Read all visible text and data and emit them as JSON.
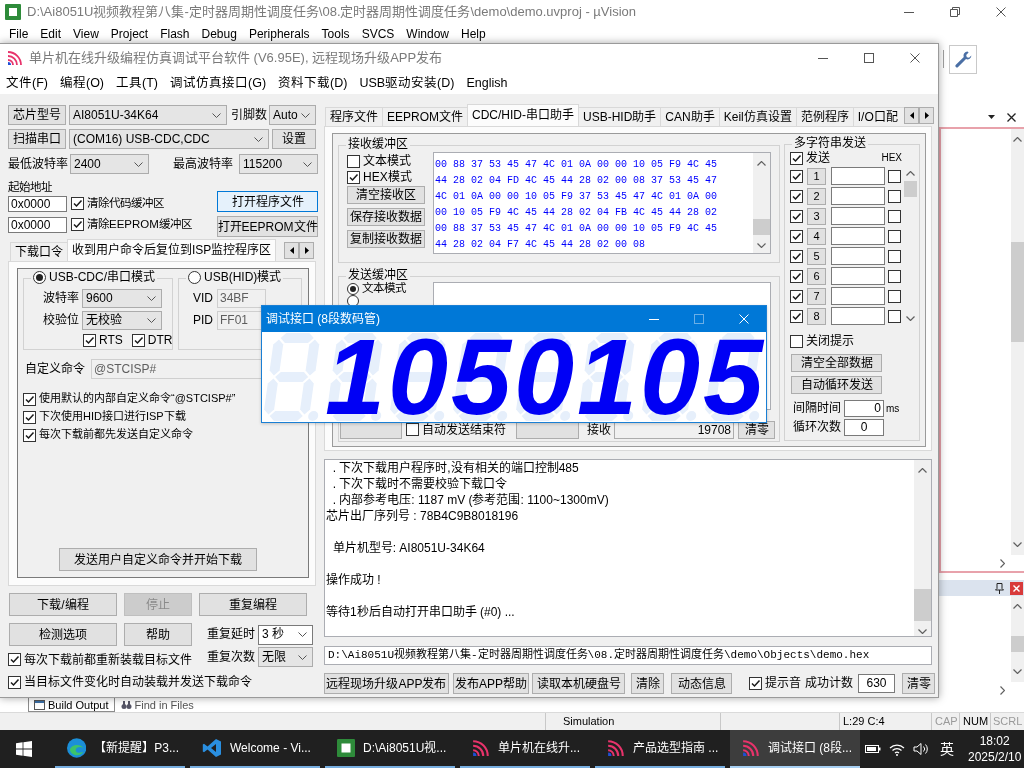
{
  "ide_window": {
    "title": "D:\\Ai8051U视频教程第八集-定时器周期性调度任务\\08.定时器周期性调度任务\\demo\\demo.uvproj - µVision",
    "menu": [
      "File",
      "Edit",
      "View",
      "Project",
      "Flash",
      "Debug",
      "Peripherals",
      "Tools",
      "SVCS",
      "Window",
      "Help"
    ],
    "output_tabs": [
      {
        "label": "Build Output",
        "selected": true
      },
      {
        "label": "Find in Files",
        "selected": false
      }
    ],
    "status_bar": {
      "mode": "Simulation",
      "position": "L:29 C:4",
      "indicators": [
        {
          "label": "CAP",
          "on": false
        },
        {
          "label": "NUM",
          "on": true
        },
        {
          "label": "SCRL",
          "on": false
        }
      ]
    }
  },
  "isp_window": {
    "title": "单片机在线升级编程仿真调试平台软件 (V6.95E), 远程现场升级APP发布",
    "menu": [
      "文件(F)",
      "编程(O)",
      "工具(T)",
      "调试仿真接口(G)",
      "资料下载(D)",
      "USB驱动安装(D)",
      "English"
    ],
    "chip_button": "芯片型号",
    "chip": "AI8051U-34K64",
    "pins_label": "引脚数",
    "pins": "Auto",
    "scan_button": "扫描串口",
    "port": "(COM16) USB-CDC,CDC",
    "settings_button": "设置",
    "min_baud_label": "最低波特率",
    "min_baud": "2400",
    "max_baud_label": "最高波特率",
    "max_baud": "115200",
    "start_address_label": "起始地址",
    "buffers": [
      {
        "address": "0x0000",
        "label": "清除代码缓冲区",
        "checked": true,
        "button": "打开程序文件",
        "focused": true
      },
      {
        "address": "0x0000",
        "label": "清除EEPROM缓冲区",
        "checked": true,
        "button": "打开EEPROM文件",
        "focused": false
      }
    ],
    "option_tabs": [
      {
        "label": "下载口令",
        "selected": false
      },
      {
        "label": "收到用户命令后复位到ISP监控程序区",
        "selected": true
      }
    ],
    "modes": [
      {
        "label": "USB-CDC/串口模式",
        "selected": true,
        "fields": [
          {
            "kind": "dropdown",
            "label": "波特率",
            "value": "9600"
          },
          {
            "kind": "dropdown",
            "label": "校验位",
            "value": "无校验"
          }
        ],
        "flags": [
          {
            "label": "RTS",
            "checked": true
          },
          {
            "label": "DTR",
            "checked": true
          }
        ]
      },
      {
        "label": "USB(HID)模式",
        "selected": false,
        "fields": [
          {
            "kind": "text",
            "label": "VID",
            "value": "34BF"
          },
          {
            "kind": "text",
            "label": "PID",
            "value": "FF01"
          }
        ]
      }
    ],
    "custom_command": {
      "label": "自定义命令",
      "value": "@STCISP#",
      "disabled": true
    },
    "command_options": [
      {
        "label": "使用默认的内部自定义命令“@STCISP#”",
        "checked": true
      },
      {
        "label": "下次使用HID接口进行ISP下载",
        "checked": true
      },
      {
        "label": "每次下载前都先发送自定义命令",
        "checked": true
      }
    ],
    "send_command_button": "发送用户自定义命令并开始下载",
    "actions": [
      {
        "label": "下载/编程",
        "disabled": false
      },
      {
        "label": "停止",
        "disabled": true
      },
      {
        "label": "重复编程",
        "disabled": false
      },
      {
        "label": "检测选项",
        "disabled": false
      },
      {
        "label": "帮助",
        "disabled": false
      }
    ],
    "repeat_delay_label": "重复延时",
    "repeat_delay": "3 秒",
    "repeat_count_label": "重复次数",
    "repeat_count": "无限",
    "reload_options": [
      {
        "label": "每次下载前都重新装载目标文件",
        "checked": true
      },
      {
        "label": "当目标文件变化时自动装载并发送下载命令",
        "checked": true
      }
    ],
    "tool_tabs": [
      {
        "label": "程序文件",
        "selected": false
      },
      {
        "label": "EEPROM文件",
        "selected": false
      },
      {
        "label": "CDC/HID-串口助手",
        "selected": true
      },
      {
        "label": "USB-HID助手",
        "selected": false
      },
      {
        "label": "CAN助手",
        "selected": false
      },
      {
        "label": "Keil仿真设置",
        "selected": false
      },
      {
        "label": "范例程序",
        "selected": false
      },
      {
        "label": "I/O口配",
        "selected": false
      }
    ],
    "receive": {
      "title": "接收缓冲区",
      "modes": [
        {
          "label": "文本模式",
          "checked": false
        },
        {
          "label": "HEX模式",
          "checked": true
        }
      ],
      "buttons": [
        "清空接收区",
        "保存接收数据",
        "复制接收数据"
      ],
      "lines": [
        "00 88 37 53 45 47 4C 01 0A 00 00 10 05 F9 4C 45",
        "44 28 02 04 FD 4C 45 44 28 02 00 08 37 53 45 47",
        "4C 01 0A 00 00 10 05 F9 37 53 45 47 4C 01 0A 00",
        "00 10 05 F9 4C 45 44 28 02 04 FB 4C 45 44 28 02",
        "00 88 37 53 45 47 4C 01 0A 00 00 10 05 F9 4C 45",
        "44 28 02 04 F7 4C 45 44 28 02 00 08"
      ]
    },
    "send": {
      "title": "发送缓冲区",
      "modes": [
        {
          "label": "文本模式",
          "selected": true
        },
        {
          "selected": false
        }
      ],
      "auto_terminator": {
        "label": "自动发送结束符",
        "checked": false
      },
      "received_label": "接收",
      "received": "19708",
      "reset_button": "清零"
    },
    "multi_send": {
      "title": "多字符串发送",
      "send": {
        "label": "发送",
        "checked": true
      },
      "hex_label": "HEX",
      "rows": [
        {
          "number": "1",
          "checked": true,
          "hex": false
        },
        {
          "number": "2",
          "checked": true,
          "hex": false
        },
        {
          "number": "3",
          "checked": true,
          "hex": false
        },
        {
          "number": "4",
          "checked": true,
          "hex": false
        },
        {
          "number": "5",
          "checked": true,
          "hex": false
        },
        {
          "number": "6",
          "checked": true,
          "hex": false
        },
        {
          "number": "7",
          "checked": true,
          "hex": false
        },
        {
          "number": "8",
          "checked": true,
          "hex": false
        }
      ],
      "close_hint": {
        "label": "关闭提示",
        "checked": false
      },
      "buttons": [
        "清空全部数据",
        "自动循环发送"
      ],
      "interval_label": "间隔时间",
      "interval": "0",
      "interval_unit": "ms",
      "loops_label": "循环次数",
      "loops": "0"
    },
    "log": [
      [
        "  . 下次下载用户程序时,没有相关的端口控制485",
        "  . 下次下载时不需要校验下载口令",
        "  . 内部参考电压: 1187 mV (参考范围: 1100~1300mV)",
        "芯片出厂序列号 : 78B4C9B8018196"
      ],
      [
        "  单片机型号: AI8051U-34K64"
      ],
      [
        "操作成功 !"
      ],
      [
        "等待1秒后自动打开串口助手 (#0) ..."
      ]
    ],
    "hex_path": "D:\\Ai8051U视频教程第八集-定时器周期性调度任务\\08.定时器周期性调度任务\\demo\\Objects\\demo.hex",
    "tools": [
      "远程现场升级APP发布",
      "发布APP帮助",
      "读取本机硬盘号",
      "清除",
      "动态信息"
    ],
    "beep": {
      "label": "提示音",
      "checked": true
    },
    "success_label": "成功计数",
    "success_count": "630",
    "success_reset_button": "清零"
  },
  "display_window": {
    "title": "调试接口 (8段数码管)",
    "digits": [
      {
        "value": "1"
      },
      {
        "value": "0"
      },
      {
        "value": "5"
      },
      {
        "value": "0"
      },
      {
        "value": "1"
      },
      {
        "value": "0"
      },
      {
        "value": "5"
      }
    ]
  },
  "taskbar": {
    "apps": [
      {
        "kind": "browser",
        "label": "【新提醒】P3...",
        "selected": false
      },
      {
        "kind": "editor",
        "label": "Welcome - Vi...",
        "selected": false
      },
      {
        "kind": "ide",
        "label": "D:\\Ai8051U视...",
        "selected": false
      },
      {
        "kind": "isp",
        "label": "单片机在线升...",
        "selected": false
      },
      {
        "kind": "isp",
        "label": "产品选型指南 ...",
        "selected": false
      },
      {
        "kind": "isp",
        "label": "调试接口 (8段...",
        "selected": true
      }
    ],
    "language": "英",
    "time": "18:02",
    "date": "2025/2/10"
  }
}
